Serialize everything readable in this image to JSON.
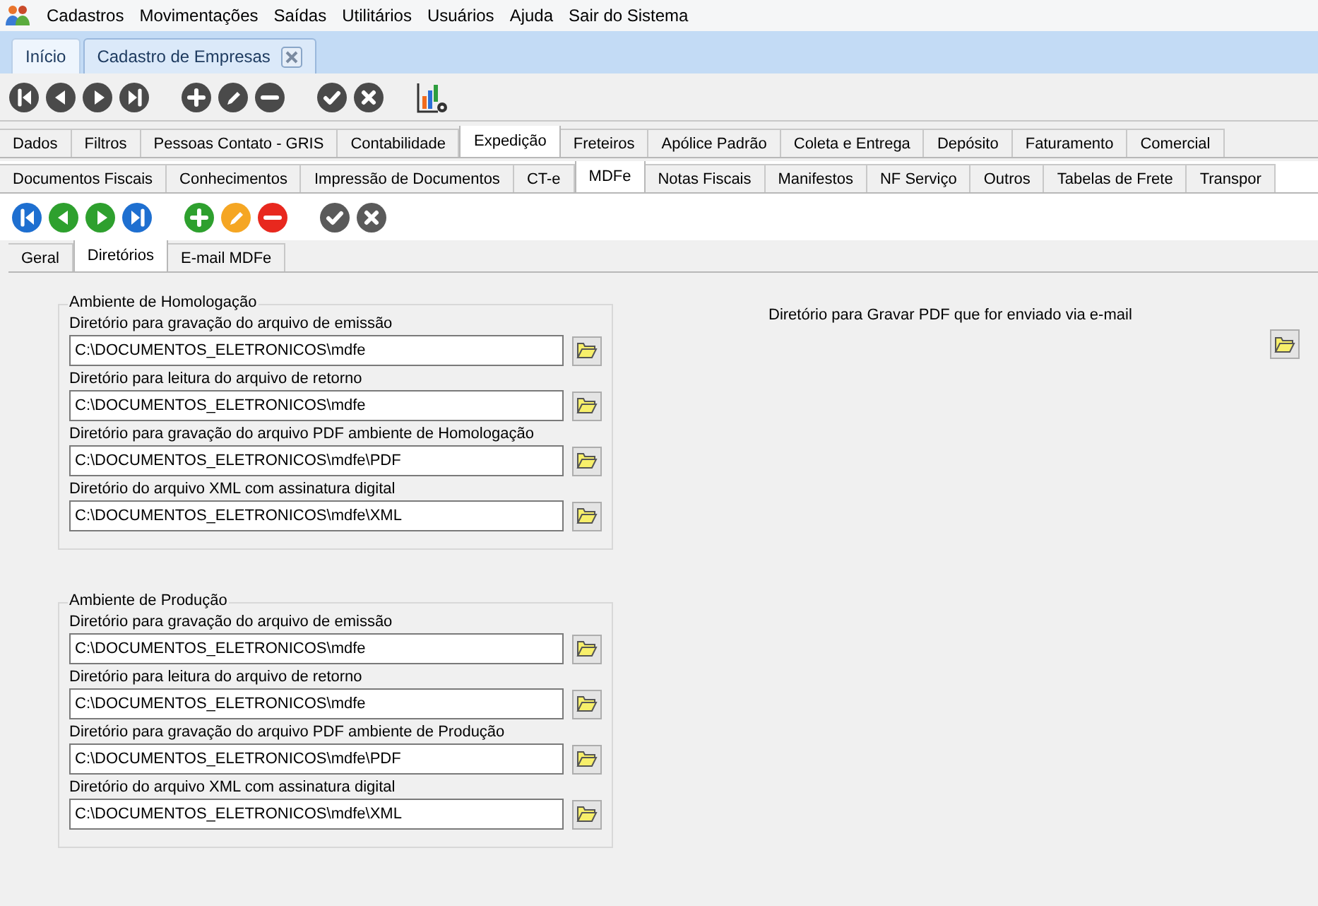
{
  "menu": [
    "Cadastros",
    "Movimentações",
    "Saídas",
    "Utilitários",
    "Usuários",
    "Ajuda",
    "Sair do Sistema"
  ],
  "doc_tabs": [
    {
      "label": "Início",
      "selected": false,
      "closable": false
    },
    {
      "label": "Cadastro de Empresas",
      "selected": true,
      "closable": true
    }
  ],
  "toolbar": [
    {
      "kind": "first",
      "color": "#4a4a4a"
    },
    {
      "kind": "prev",
      "color": "#4a4a4a"
    },
    {
      "kind": "next",
      "color": "#4a4a4a"
    },
    {
      "kind": "last",
      "color": "#4a4a4a"
    },
    {
      "kind": "gap"
    },
    {
      "kind": "add",
      "color": "#4a4a4a"
    },
    {
      "kind": "edit",
      "color": "#4a4a4a"
    },
    {
      "kind": "remove",
      "color": "#4a4a4a"
    },
    {
      "kind": "gap"
    },
    {
      "kind": "confirm",
      "color": "#4a4a4a"
    },
    {
      "kind": "cancel",
      "color": "#4a4a4a"
    },
    {
      "kind": "gap"
    },
    {
      "kind": "chart"
    }
  ],
  "tabs_row1": [
    {
      "label": "Dados",
      "selected": false
    },
    {
      "label": "Filtros",
      "selected": false
    },
    {
      "label": "Pessoas Contato - GRIS",
      "selected": false
    },
    {
      "label": "Contabilidade",
      "selected": false
    },
    {
      "label": "Expedição",
      "selected": true
    },
    {
      "label": "Freteiros",
      "selected": false
    },
    {
      "label": "Apólice Padrão",
      "selected": false
    },
    {
      "label": "Coleta e Entrega",
      "selected": false
    },
    {
      "label": "Depósito",
      "selected": false
    },
    {
      "label": "Faturamento",
      "selected": false
    },
    {
      "label": "Comercial",
      "selected": false
    }
  ],
  "tabs_row2": [
    {
      "label": "Documentos Fiscais",
      "selected": false
    },
    {
      "label": "Conhecimentos",
      "selected": false
    },
    {
      "label": "Impressão de Documentos",
      "selected": false
    },
    {
      "label": "CT-e",
      "selected": false
    },
    {
      "label": "MDFe",
      "selected": true
    },
    {
      "label": "Notas Fiscais",
      "selected": false
    },
    {
      "label": "Manifestos",
      "selected": false
    },
    {
      "label": "NF Serviço",
      "selected": false
    },
    {
      "label": "Outros",
      "selected": false
    },
    {
      "label": "Tabelas de Frete",
      "selected": false
    },
    {
      "label": "Transpor",
      "selected": false
    }
  ],
  "toolbar2": [
    {
      "kind": "first",
      "color": "#1e6fd0"
    },
    {
      "kind": "prev",
      "color": "#2ea02e"
    },
    {
      "kind": "next",
      "color": "#2ea02e"
    },
    {
      "kind": "last",
      "color": "#1e6fd0"
    },
    {
      "kind": "gap"
    },
    {
      "kind": "add",
      "color": "#2ea02e"
    },
    {
      "kind": "edit",
      "color": "#f5a623"
    },
    {
      "kind": "remove",
      "color": "#e8281e"
    },
    {
      "kind": "gap"
    },
    {
      "kind": "confirm",
      "color": "#5a5a5a"
    },
    {
      "kind": "cancel",
      "color": "#5a5a5a"
    }
  ],
  "sub_tabs": [
    {
      "label": "Geral",
      "selected": false
    },
    {
      "label": "Diretórios",
      "selected": true
    },
    {
      "label": "E-mail MDFe",
      "selected": false
    }
  ],
  "groups": [
    {
      "title": "Ambiente de Homologação",
      "fields": [
        {
          "label": "Diretório para gravação do arquivo de emissão",
          "value": "C:\\DOCUMENTOS_ELETRONICOS\\mdfe"
        },
        {
          "label": "Diretório para leitura do arquivo de retorno",
          "value": "C:\\DOCUMENTOS_ELETRONICOS\\mdfe"
        },
        {
          "label": "Diretório para gravação do arquivo PDF ambiente de Homologação",
          "value": "C:\\DOCUMENTOS_ELETRONICOS\\mdfe\\PDF"
        },
        {
          "label": "Diretório do arquivo XML com assinatura digital",
          "value": "C:\\DOCUMENTOS_ELETRONICOS\\mdfe\\XML"
        }
      ]
    },
    {
      "title": "Ambiente de Produção",
      "fields": [
        {
          "label": "Diretório para gravação do arquivo de emissão",
          "value": "C:\\DOCUMENTOS_ELETRONICOS\\mdfe"
        },
        {
          "label": "Diretório para leitura do arquivo de retorno",
          "value": "C:\\DOCUMENTOS_ELETRONICOS\\mdfe"
        },
        {
          "label": "Diretório para gravação do arquivo PDF ambiente de Produção",
          "value": "C:\\DOCUMENTOS_ELETRONICOS\\mdfe\\PDF"
        },
        {
          "label": "Diretório do arquivo XML com assinatura digital",
          "value": "C:\\DOCUMENTOS_ELETRONICOS\\mdfe\\XML"
        }
      ]
    }
  ],
  "email_pdf": {
    "label": "Diretório para Gravar PDF que for enviado via e-mail"
  }
}
